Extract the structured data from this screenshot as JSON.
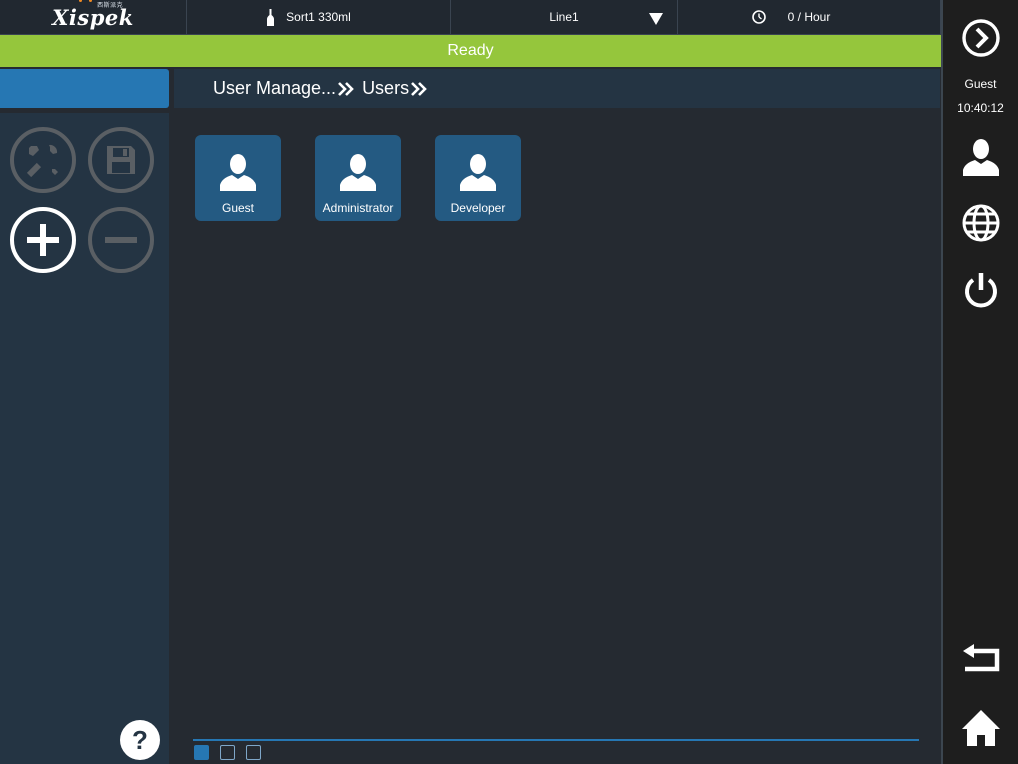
{
  "topbar": {
    "logo": "Xispek",
    "logo_sub": "西斯派克",
    "product": "Sort1 330ml",
    "line": "Line1",
    "rate": "0 / Hour"
  },
  "status": {
    "text": "Ready"
  },
  "breadcrumb": [
    {
      "label": "User Manage..."
    },
    {
      "label": "Users"
    }
  ],
  "users": [
    {
      "label": "Guest"
    },
    {
      "label": "Administrator"
    },
    {
      "label": "Developer"
    }
  ],
  "pagination": {
    "pages": 3,
    "current": 1
  },
  "sidebar": {
    "user": "Guest",
    "time": "10:40:12"
  },
  "icons": {
    "product": "bottle-icon",
    "rate": "clock-icon",
    "line": "dropdown-arrow-icon",
    "tools": "tools-icon",
    "save": "save-icon",
    "add": "plus-icon",
    "remove": "minus-icon",
    "help": "help-icon",
    "user_card": "user-icon",
    "forward": "forward-icon",
    "user_account": "user-icon",
    "language": "globe-icon",
    "power": "power-icon",
    "back": "back-icon",
    "home": "home-icon"
  },
  "colors": {
    "status_ready": "#95c63c",
    "accent": "#2677b3",
    "card": "#245a82",
    "panel": "#243443",
    "background": "#252a31",
    "sidebar": "#1e1e1e",
    "logo_dots": "#f08a24"
  }
}
